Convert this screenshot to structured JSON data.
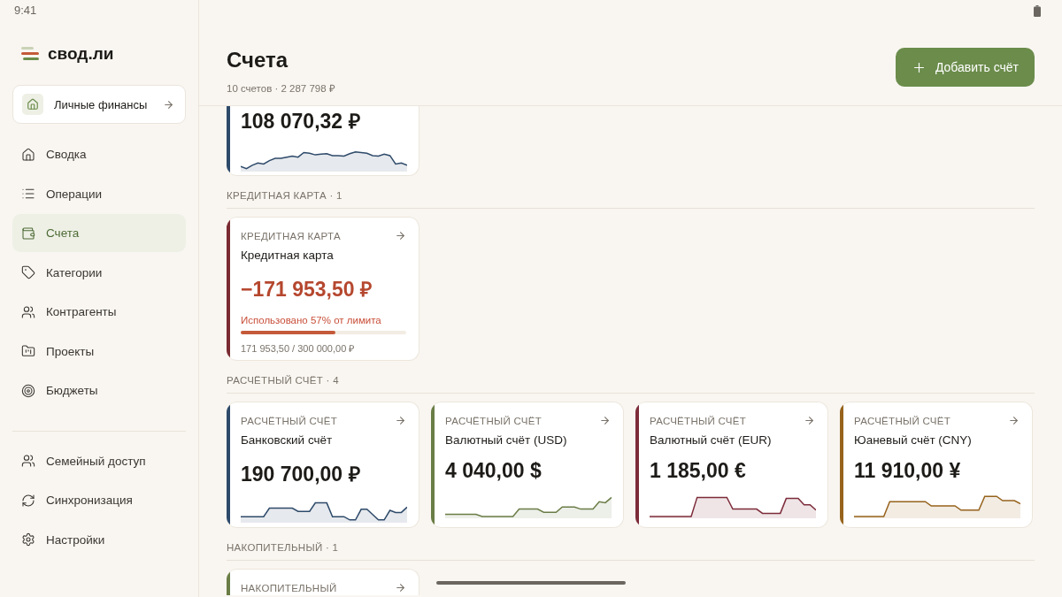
{
  "status_bar": {
    "time": "9:41"
  },
  "sidebar": {
    "logo": "свод.ли",
    "workspace": {
      "label": "Личные финансы"
    },
    "nav": [
      {
        "label": "Сводка",
        "selected": false
      },
      {
        "label": "Операции",
        "selected": false
      },
      {
        "label": "Счета",
        "selected": true
      },
      {
        "label": "Категории",
        "selected": false
      },
      {
        "label": "Контрагенты",
        "selected": false
      },
      {
        "label": "Проекты",
        "selected": false
      },
      {
        "label": "Бюджеты",
        "selected": false
      }
    ],
    "footer_nav": [
      {
        "label": "Семейный доступ"
      },
      {
        "label": "Синхронизация"
      },
      {
        "label": "Настройки"
      }
    ]
  },
  "header": {
    "title": "Счета",
    "subtitle": "10 счетов · 2 287 798 ₽",
    "add_button": "Добавить счёт"
  },
  "sections": [
    {
      "accounts": [
        {
          "kind": "sparkline",
          "amount": "108 070,32 ₽",
          "color": "#2e4a6a"
        }
      ]
    },
    {
      "heading": "КРЕДИТНАЯ КАРТА · 1",
      "accounts": [
        {
          "kind": "credit",
          "type_label": "КРЕДИТНАЯ КАРТА",
          "name": "Кредитная карта",
          "amount": "−171 953,50 ₽",
          "usage": "Использовано 57% от лимита",
          "level": 0.57,
          "limit": "171 953,50 / 300 000,00 ₽",
          "color": "#7a2a32"
        }
      ]
    },
    {
      "heading": "РАСЧЁТНЫЙ СЧЁТ · 4",
      "accounts": [
        {
          "kind": "sparkline",
          "type_label": "РАСЧЁТНЫЙ СЧЁТ",
          "name": "Банковский счёт",
          "amount": "190 700,00 ₽",
          "color": "#2e4a6a"
        },
        {
          "kind": "sparkline",
          "type_label": "РАСЧЁТНЫЙ СЧЁТ",
          "name": "Валютный счёт (USD)",
          "amount": "4 040,00 $",
          "color": "#6a7d46"
        },
        {
          "kind": "sparkline",
          "type_label": "РАСЧЁТНЫЙ СЧЁТ",
          "name": "Валютный счёт (EUR)",
          "amount": "1 185,00 €",
          "color": "#7d2c3a"
        },
        {
          "kind": "sparkline",
          "type_label": "РАСЧЁТНЫЙ СЧЁТ",
          "name": "Юаневый счёт (CNY)",
          "amount": "11 910,00 ¥",
          "color": "#96621c"
        }
      ]
    },
    {
      "heading": "НАКОПИТЕЛЬНЫЙ · 1",
      "accounts": [
        {
          "kind": "cut",
          "type_label": "НАКОПИТЕЛЬНЫЙ",
          "color": "#6a7d46"
        }
      ]
    }
  ]
}
